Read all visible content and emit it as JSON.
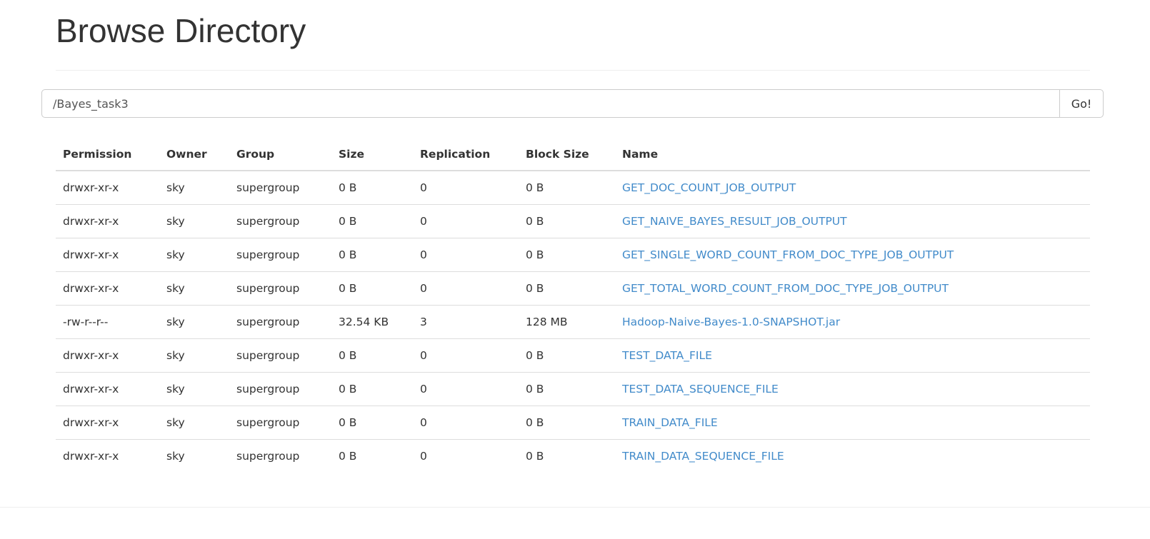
{
  "page_title": "Browse Directory",
  "path_input": {
    "value": "/Bayes_task3",
    "button": "Go!"
  },
  "table": {
    "headers": [
      "Permission",
      "Owner",
      "Group",
      "Size",
      "Replication",
      "Block Size",
      "Name"
    ],
    "rows": [
      [
        "drwxr-xr-x",
        "sky",
        "supergroup",
        "0 B",
        "0",
        "0 B",
        "GET_DOC_COUNT_JOB_OUTPUT"
      ],
      [
        "drwxr-xr-x",
        "sky",
        "supergroup",
        "0 B",
        "0",
        "0 B",
        "GET_NAIVE_BAYES_RESULT_JOB_OUTPUT"
      ],
      [
        "drwxr-xr-x",
        "sky",
        "supergroup",
        "0 B",
        "0",
        "0 B",
        "GET_SINGLE_WORD_COUNT_FROM_DOC_TYPE_JOB_OUTPUT"
      ],
      [
        "drwxr-xr-x",
        "sky",
        "supergroup",
        "0 B",
        "0",
        "0 B",
        "GET_TOTAL_WORD_COUNT_FROM_DOC_TYPE_JOB_OUTPUT"
      ],
      [
        "-rw-r--r--",
        "sky",
        "supergroup",
        "32.54 KB",
        "3",
        "128 MB",
        "Hadoop-Naive-Bayes-1.0-SNAPSHOT.jar"
      ],
      [
        "drwxr-xr-x",
        "sky",
        "supergroup",
        "0 B",
        "0",
        "0 B",
        "TEST_DATA_FILE"
      ],
      [
        "drwxr-xr-x",
        "sky",
        "supergroup",
        "0 B",
        "0",
        "0 B",
        "TEST_DATA_SEQUENCE_FILE"
      ],
      [
        "drwxr-xr-x",
        "sky",
        "supergroup",
        "0 B",
        "0",
        "0 B",
        "TRAIN_DATA_FILE"
      ],
      [
        "drwxr-xr-x",
        "sky",
        "supergroup",
        "0 B",
        "0",
        "0 B",
        "TRAIN_DATA_SEQUENCE_FILE"
      ]
    ]
  },
  "colors": {
    "link": "#428bca",
    "text": "#333333"
  }
}
